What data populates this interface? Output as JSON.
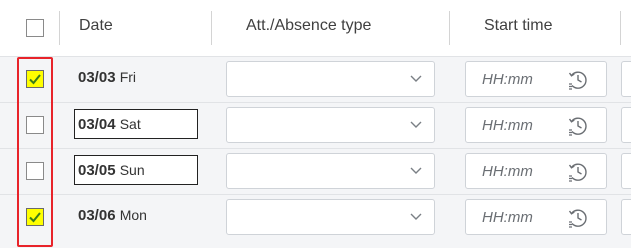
{
  "header": {
    "select_all_checked": false,
    "date_label": "Date",
    "type_label": "Att./Absence type",
    "start_label": "Start time"
  },
  "rows": [
    {
      "date": "03/03",
      "weekday": "Fri",
      "checked": true,
      "focused": false,
      "type_value": "",
      "start_placeholder": "HH:mm"
    },
    {
      "date": "03/04",
      "weekday": "Sat",
      "checked": false,
      "focused": true,
      "type_value": "",
      "start_placeholder": "HH:mm"
    },
    {
      "date": "03/05",
      "weekday": "Sun",
      "checked": false,
      "focused": true,
      "type_value": "",
      "start_placeholder": "HH:mm"
    },
    {
      "date": "03/06",
      "weekday": "Mon",
      "checked": true,
      "focused": false,
      "type_value": "",
      "start_placeholder": "HH:mm"
    }
  ],
  "icons": {
    "dropdown": "chevron-down-icon",
    "time": "clock-icon",
    "check": "checkmark-icon"
  },
  "colors": {
    "checked_fill": "#ffff00",
    "highlight_border": "#e8232a",
    "row_background": "#f4f5f7"
  }
}
